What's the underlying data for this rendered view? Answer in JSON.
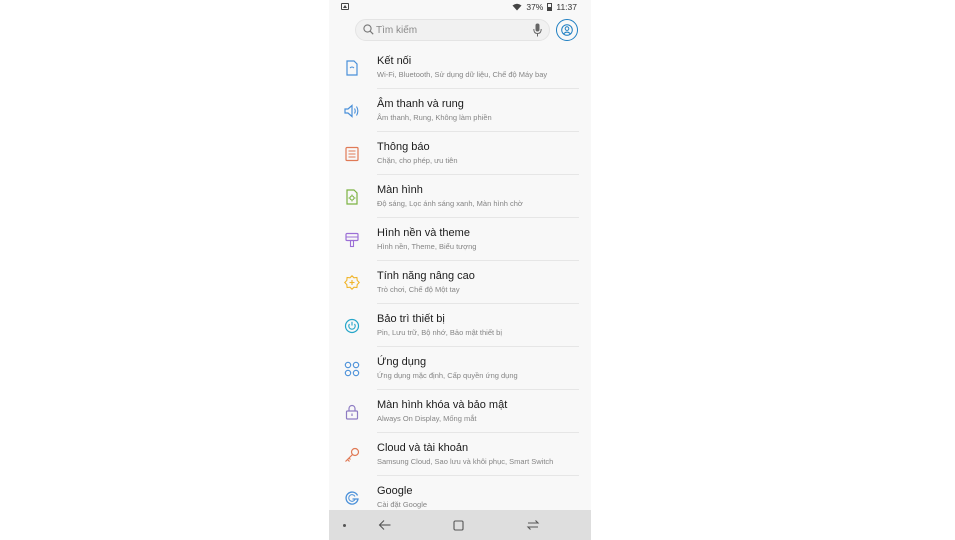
{
  "status_bar": {
    "battery_percent": "37%",
    "time": "11:37"
  },
  "search": {
    "placeholder": "Tìm kiếm"
  },
  "settings_items": [
    {
      "title": "Kết nối",
      "subtitle": "Wi-Fi, Bluetooth, Sử dụng dữ liệu, Chế độ Máy bay",
      "icon": "connections-icon",
      "color": "#4a90d9"
    },
    {
      "title": "Âm thanh và rung",
      "subtitle": "Âm thanh, Rung, Không làm phiền",
      "icon": "sound-icon",
      "color": "#4a90d9"
    },
    {
      "title": "Thông báo",
      "subtitle": "Chặn, cho phép, ưu tiên",
      "icon": "notifications-icon",
      "color": "#e07a56"
    },
    {
      "title": "Màn hình",
      "subtitle": "Độ sáng, Lọc ánh sáng xanh, Màn hình chờ",
      "icon": "display-icon",
      "color": "#7cb342"
    },
    {
      "title": "Hình nền và theme",
      "subtitle": "Hình nền, Theme, Biểu tượng",
      "icon": "wallpaper-icon",
      "color": "#9c6fd6"
    },
    {
      "title": "Tính năng nâng cao",
      "subtitle": "Trò chơi, Chế độ Một tay",
      "icon": "advanced-features-icon",
      "color": "#f0b429"
    },
    {
      "title": "Bảo trì thiết bị",
      "subtitle": "Pin, Lưu trữ, Bộ nhớ, Bảo mật thiết bị",
      "icon": "device-maintenance-icon",
      "color": "#26a6c9"
    },
    {
      "title": "Ứng dụng",
      "subtitle": "Ứng dụng mặc định, Cấp quyền ứng dụng",
      "icon": "apps-icon",
      "color": "#4a90d9"
    },
    {
      "title": "Màn hình khóa và bảo mật",
      "subtitle": "Always On Display, Mống mắt",
      "icon": "lock-icon",
      "color": "#8e7cc3"
    },
    {
      "title": "Cloud và tài khoản",
      "subtitle": "Samsung Cloud, Sao lưu và khôi phục, Smart Switch",
      "icon": "key-icon",
      "color": "#e07a56"
    },
    {
      "title": "Google",
      "subtitle": "Cài đặt Google",
      "icon": "google-icon",
      "color": "#4a90d9"
    }
  ]
}
